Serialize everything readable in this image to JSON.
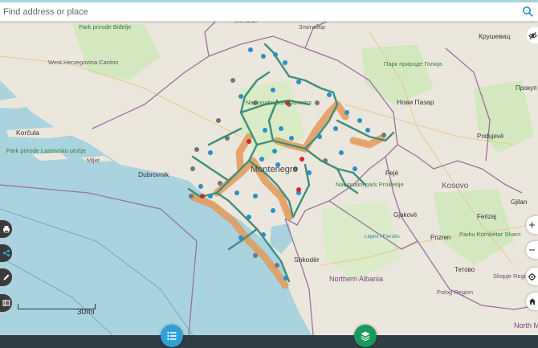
{
  "search": {
    "placeholder": "Find address or place"
  },
  "scale": {
    "label": "30mi"
  },
  "map_labels": {
    "park_bidjelje": "Park prirode Biđelje",
    "west_herzegovina": "West Herzegovina Canton",
    "gorazde": "Goražde",
    "zlatibor": "Златибор",
    "krusevac": "Крушевац",
    "park_golija": "Парк природе Голија",
    "nacionalni_park": "Nacionalni park Durmitor",
    "novi_pazar": "Нови Пазар",
    "prokuplje": "Прокуп",
    "korcula": "Korčula",
    "park_lastovsko": "Park prirode Lastovsko otočje",
    "mljet": "Mljet",
    "dubrovnik": "Dubrovnik",
    "montenegro": "Montenegro",
    "prokletije": "Nacionalni park Prokletije",
    "peje": "Pejë",
    "kosovo": "Kosovo",
    "podujeve": "Podujevë",
    "gjakove": "Gjakovë",
    "ferizaj": "Ferizaj",
    "gjilan": "Gjilan",
    "prizren": "Prizren",
    "park_sharr": "Parku Kombëtar Sharri",
    "tetovo": "Тетово",
    "skopje": "Skopje Region",
    "polog": "Polog Region",
    "shkoder": "Shkodër",
    "northern_albania": "Northern Albania",
    "lake_shkoder": "Liqeni i Fierzës",
    "north_m": "North M"
  },
  "colors": {
    "sea": "#a9d3df",
    "land": "#ece7dc",
    "forest": "#cfe5b8",
    "border": "#9a6fa0",
    "route_green": "#3e8e7a",
    "route_orange": "#e39a5a",
    "poi_blue": "#2a8fc8",
    "poi_gray": "#6f7778",
    "poi_red": "#cc2a2a",
    "bottom_bar": "#2e3d44",
    "list_button": "#2f9fd8",
    "layers_button": "#1a9a5a"
  }
}
